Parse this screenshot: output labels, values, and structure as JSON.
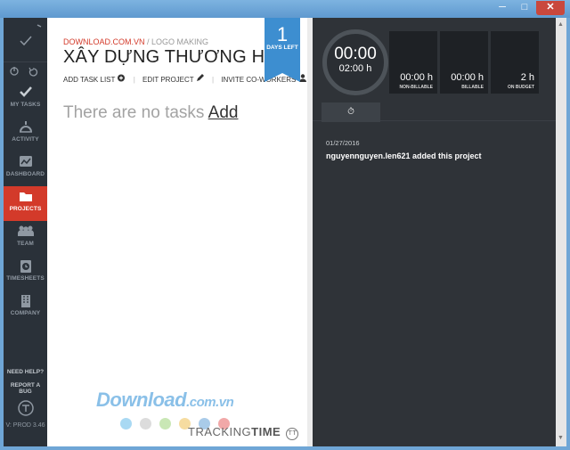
{
  "window": {
    "min": "─",
    "max": "□",
    "close": "✕"
  },
  "sidebar": {
    "items": [
      {
        "label": "MY TASKS",
        "icon": "check-icon"
      },
      {
        "label": "ACTIVITY",
        "icon": "activity-icon"
      },
      {
        "label": "DASHBOARD",
        "icon": "dashboard-icon"
      },
      {
        "label": "PROJECTS",
        "icon": "folder-icon",
        "active": true
      },
      {
        "label": "TEAM",
        "icon": "team-icon"
      },
      {
        "label": "TIMESHEETS",
        "icon": "timesheet-icon"
      },
      {
        "label": "COMPANY",
        "icon": "building-icon"
      }
    ],
    "need_help": "NEED HELP?",
    "report_bug": "REPORT A BUG",
    "version": "V: PROD 3.46"
  },
  "project": {
    "org": "DOWNLOAD.COM.VN",
    "sep": " / ",
    "client": "LOGO MAKING",
    "title": "XÂY DỰNG THƯƠNG HIỆU",
    "add_task_list": "ADD TASK LIST",
    "edit_project": "EDIT PROJECT",
    "invite": "INVITE CO-WORKERS",
    "pipe": "|",
    "empty_text": "There are no tasks",
    "empty_add": "Add",
    "days_num": "1",
    "days_label": "DAYS LEFT"
  },
  "color_dots": [
    "#a9d9f3",
    "#dcdcdc",
    "#c9e7b5",
    "#f6dca0",
    "#a9cbe9",
    "#f1a8a8"
  ],
  "brand": {
    "a": "TRACKING",
    "b": "TIME",
    "mark": "TT"
  },
  "timer": {
    "main": "00:00",
    "sub": "02:00 h"
  },
  "stats": [
    {
      "value": "00:00 h",
      "label": "NON-BILLABLE"
    },
    {
      "value": "00:00 h",
      "label": "BILLABLE"
    },
    {
      "value": "2 h",
      "label": "ON BUDGET"
    }
  ],
  "feed": {
    "tab_icon": "⏱",
    "date": "01/27/2016",
    "text": "nguyennguyen.len621 added this project"
  },
  "watermark": {
    "main": "Download",
    "suffix": ".com.vn"
  }
}
